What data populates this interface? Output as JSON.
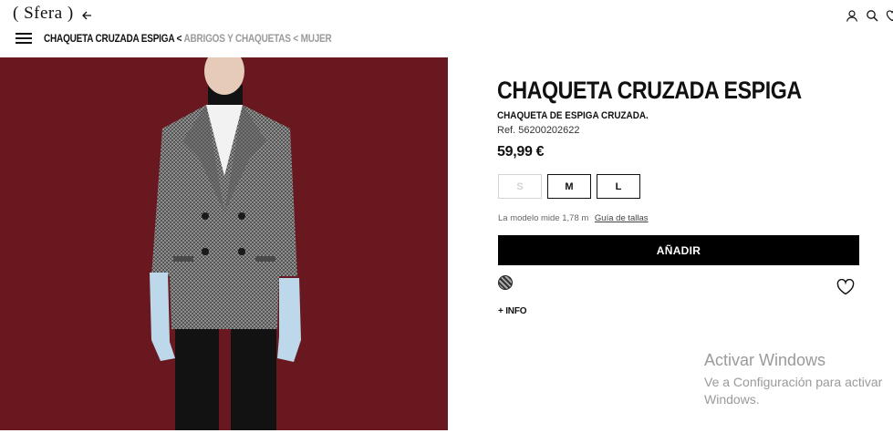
{
  "header": {
    "logo_text": "( Sfera )",
    "icons": [
      "back-arrow-icon",
      "user-icon",
      "search-icon",
      "heart-icon",
      "menu-icon"
    ]
  },
  "breadcrumb": {
    "current": "CHAQUETA CRUZADA ESPIGA",
    "sep1": " < ",
    "parent": "ABRIGOS Y CHAQUETAS",
    "sep2": " < ",
    "root": "MUJER"
  },
  "product": {
    "title": "CHAQUETA CRUZADA ESPIGA",
    "subtitle": "CHAQUETA DE ESPIGA CRUZADA.",
    "reference": "Ref. 56200202622",
    "price": "59,99 €",
    "sizes": [
      {
        "label": "S",
        "available": false
      },
      {
        "label": "M",
        "available": true
      },
      {
        "label": "L",
        "available": true
      }
    ],
    "model_info": "La modelo mide 1,78 m",
    "size_guide": "Guía de tallas",
    "add_button": "AÑADIR",
    "info_link": "+ INFO"
  },
  "colors": {
    "background_image": "#6e1a22",
    "button": "#000000"
  },
  "watermark": {
    "line1": "Activar Windows",
    "line2": "Ve a Configuración para activar",
    "line3": "Windows."
  }
}
